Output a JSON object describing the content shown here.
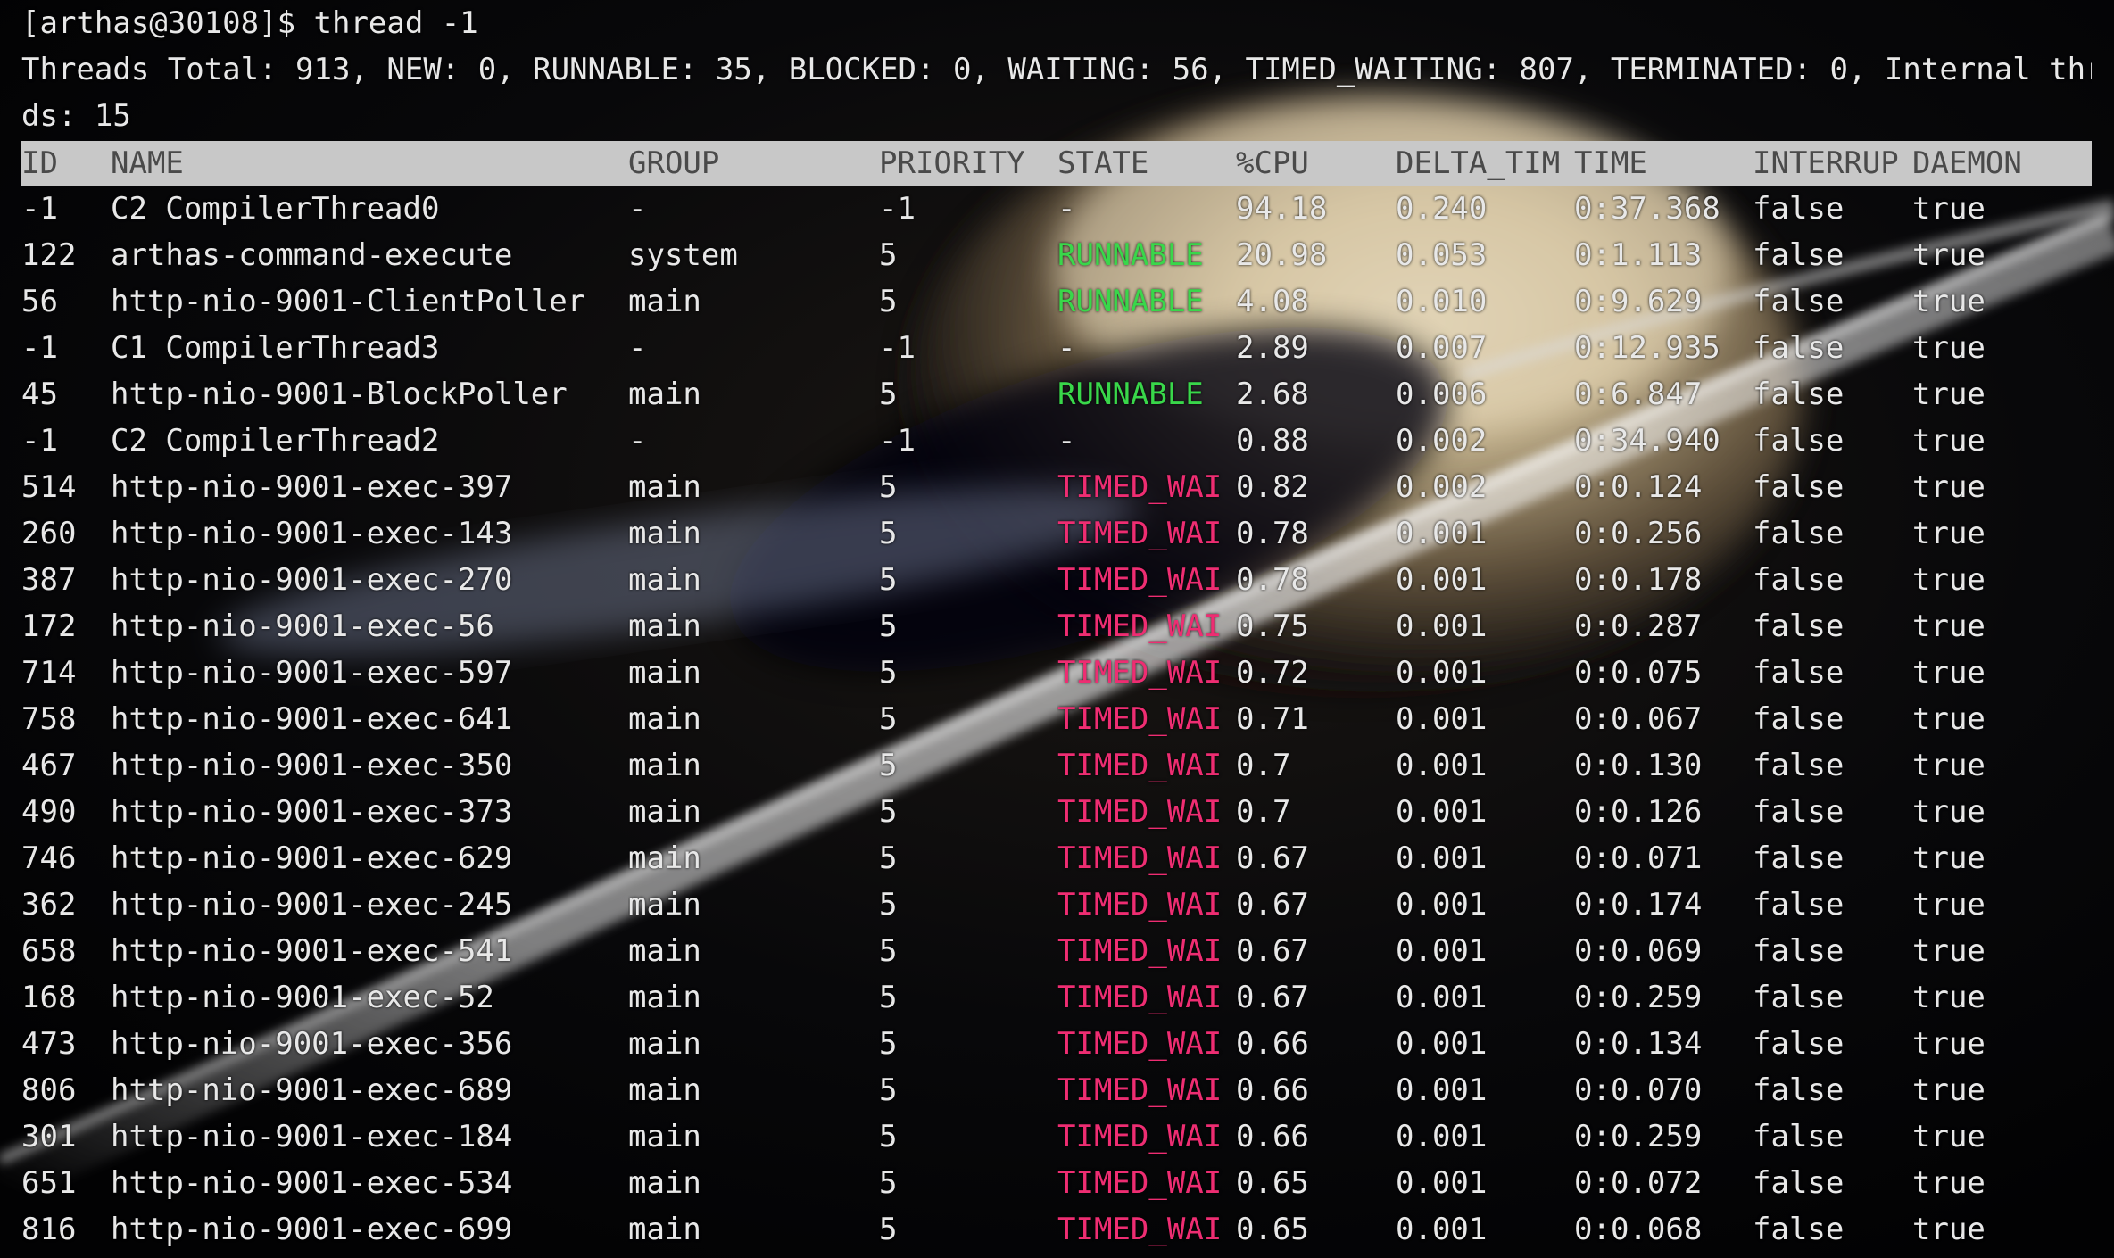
{
  "terminal": {
    "prompt_line": "[arthas@30108]$ thread -1",
    "summary_line1": "Threads Total: 913, NEW: 0, RUNNABLE: 35, BLOCKED: 0, WAITING: 56, TIMED_WAITING: 807, TERMINATED: 0, Internal threa",
    "summary_line2": "ds: 15"
  },
  "table": {
    "headers": {
      "id": "ID",
      "name": "NAME",
      "group": "GROUP",
      "priority": "PRIORITY",
      "state": "STATE",
      "cpu": "%CPU",
      "delta": "DELTA_TIM",
      "time": "TIME",
      "interrupt": "INTERRUP",
      "daemon": "DAEMON"
    },
    "rows": [
      {
        "id": "-1",
        "name": "C2 CompilerThread0",
        "group": "-",
        "priority": "-1",
        "state": "-",
        "cpu": "94.18",
        "delta": "0.240",
        "time": "0:37.368",
        "interrupt": "false",
        "daemon": "true"
      },
      {
        "id": "122",
        "name": "arthas-command-execute",
        "group": "system",
        "priority": "5",
        "state": "RUNNABLE",
        "cpu": "20.98",
        "delta": "0.053",
        "time": "0:1.113",
        "interrupt": "false",
        "daemon": "true"
      },
      {
        "id": "56",
        "name": "http-nio-9001-ClientPoller",
        "group": "main",
        "priority": "5",
        "state": "RUNNABLE",
        "cpu": "4.08",
        "delta": "0.010",
        "time": "0:9.629",
        "interrupt": "false",
        "daemon": "true"
      },
      {
        "id": "-1",
        "name": "C1 CompilerThread3",
        "group": "-",
        "priority": "-1",
        "state": "-",
        "cpu": "2.89",
        "delta": "0.007",
        "time": "0:12.935",
        "interrupt": "false",
        "daemon": "true"
      },
      {
        "id": "45",
        "name": "http-nio-9001-BlockPoller",
        "group": "main",
        "priority": "5",
        "state": "RUNNABLE",
        "cpu": "2.68",
        "delta": "0.006",
        "time": "0:6.847",
        "interrupt": "false",
        "daemon": "true"
      },
      {
        "id": "-1",
        "name": "C2 CompilerThread2",
        "group": "-",
        "priority": "-1",
        "state": "-",
        "cpu": "0.88",
        "delta": "0.002",
        "time": "0:34.940",
        "interrupt": "false",
        "daemon": "true"
      },
      {
        "id": "514",
        "name": "http-nio-9001-exec-397",
        "group": "main",
        "priority": "5",
        "state": "TIMED_WAI",
        "cpu": "0.82",
        "delta": "0.002",
        "time": "0:0.124",
        "interrupt": "false",
        "daemon": "true"
      },
      {
        "id": "260",
        "name": "http-nio-9001-exec-143",
        "group": "main",
        "priority": "5",
        "state": "TIMED_WAI",
        "cpu": "0.78",
        "delta": "0.001",
        "time": "0:0.256",
        "interrupt": "false",
        "daemon": "true"
      },
      {
        "id": "387",
        "name": "http-nio-9001-exec-270",
        "group": "main",
        "priority": "5",
        "state": "TIMED_WAI",
        "cpu": "0.78",
        "delta": "0.001",
        "time": "0:0.178",
        "interrupt": "false",
        "daemon": "true"
      },
      {
        "id": "172",
        "name": "http-nio-9001-exec-56",
        "group": "main",
        "priority": "5",
        "state": "TIMED_WAI",
        "cpu": "0.75",
        "delta": "0.001",
        "time": "0:0.287",
        "interrupt": "false",
        "daemon": "true"
      },
      {
        "id": "714",
        "name": "http-nio-9001-exec-597",
        "group": "main",
        "priority": "5",
        "state": "TIMED_WAI",
        "cpu": "0.72",
        "delta": "0.001",
        "time": "0:0.075",
        "interrupt": "false",
        "daemon": "true"
      },
      {
        "id": "758",
        "name": "http-nio-9001-exec-641",
        "group": "main",
        "priority": "5",
        "state": "TIMED_WAI",
        "cpu": "0.71",
        "delta": "0.001",
        "time": "0:0.067",
        "interrupt": "false",
        "daemon": "true"
      },
      {
        "id": "467",
        "name": "http-nio-9001-exec-350",
        "group": "main",
        "priority": "5",
        "state": "TIMED_WAI",
        "cpu": "0.7",
        "delta": "0.001",
        "time": "0:0.130",
        "interrupt": "false",
        "daemon": "true"
      },
      {
        "id": "490",
        "name": "http-nio-9001-exec-373",
        "group": "main",
        "priority": "5",
        "state": "TIMED_WAI",
        "cpu": "0.7",
        "delta": "0.001",
        "time": "0:0.126",
        "interrupt": "false",
        "daemon": "true"
      },
      {
        "id": "746",
        "name": "http-nio-9001-exec-629",
        "group": "main",
        "priority": "5",
        "state": "TIMED_WAI",
        "cpu": "0.67",
        "delta": "0.001",
        "time": "0:0.071",
        "interrupt": "false",
        "daemon": "true"
      },
      {
        "id": "362",
        "name": "http-nio-9001-exec-245",
        "group": "main",
        "priority": "5",
        "state": "TIMED_WAI",
        "cpu": "0.67",
        "delta": "0.001",
        "time": "0:0.174",
        "interrupt": "false",
        "daemon": "true"
      },
      {
        "id": "658",
        "name": "http-nio-9001-exec-541",
        "group": "main",
        "priority": "5",
        "state": "TIMED_WAI",
        "cpu": "0.67",
        "delta": "0.001",
        "time": "0:0.069",
        "interrupt": "false",
        "daemon": "true"
      },
      {
        "id": "168",
        "name": "http-nio-9001-exec-52",
        "group": "main",
        "priority": "5",
        "state": "TIMED_WAI",
        "cpu": "0.67",
        "delta": "0.001",
        "time": "0:0.259",
        "interrupt": "false",
        "daemon": "true"
      },
      {
        "id": "473",
        "name": "http-nio-9001-exec-356",
        "group": "main",
        "priority": "5",
        "state": "TIMED_WAI",
        "cpu": "0.66",
        "delta": "0.001",
        "time": "0:0.134",
        "interrupt": "false",
        "daemon": "true"
      },
      {
        "id": "806",
        "name": "http-nio-9001-exec-689",
        "group": "main",
        "priority": "5",
        "state": "TIMED_WAI",
        "cpu": "0.66",
        "delta": "0.001",
        "time": "0:0.070",
        "interrupt": "false",
        "daemon": "true"
      },
      {
        "id": "301",
        "name": "http-nio-9001-exec-184",
        "group": "main",
        "priority": "5",
        "state": "TIMED_WAI",
        "cpu": "0.66",
        "delta": "0.001",
        "time": "0:0.259",
        "interrupt": "false",
        "daemon": "true"
      },
      {
        "id": "651",
        "name": "http-nio-9001-exec-534",
        "group": "main",
        "priority": "5",
        "state": "TIMED_WAI",
        "cpu": "0.65",
        "delta": "0.001",
        "time": "0:0.072",
        "interrupt": "false",
        "daemon": "true"
      },
      {
        "id": "816",
        "name": "http-nio-9001-exec-699",
        "group": "main",
        "priority": "5",
        "state": "TIMED_WAI",
        "cpu": "0.65",
        "delta": "0.001",
        "time": "0:0.068",
        "interrupt": "false",
        "daemon": "true"
      }
    ]
  },
  "colors": {
    "background": "#050507",
    "text": "#e8e8e8",
    "header_bg": "#c8c8c8",
    "header_text": "#4a4a4a",
    "runnable": "#39d74a",
    "timed_waiting": "#ee2d72"
  }
}
